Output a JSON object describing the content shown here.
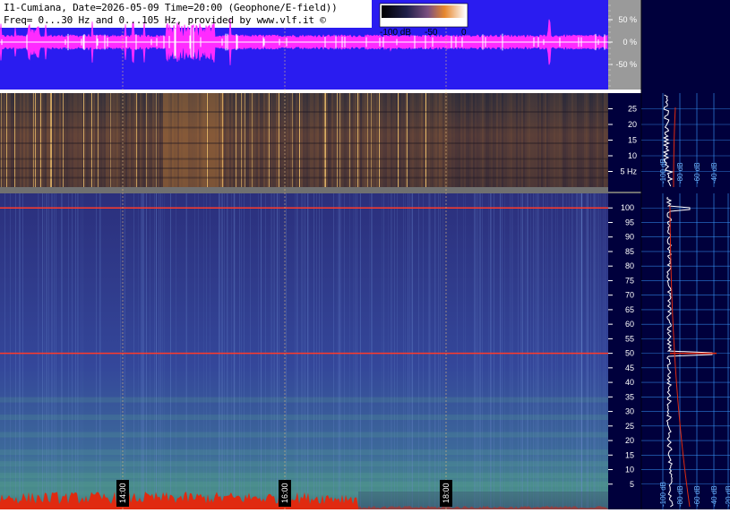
{
  "header": {
    "line1": "I1-Cumiana, Date=2026-05-09 Time=20:00 (Geophone/E-field))",
    "line2": "Freq= 0...30 Hz and 0...105 Hz, provided by www.vlf.it ©"
  },
  "colorbar": {
    "labels": [
      "-100 dB",
      "-50",
      "0"
    ]
  },
  "colors": {
    "waveform_bg": "#2a1cf0",
    "waveform": "#ff2bff",
    "spectrogram_low_bg": "#3a2a38",
    "spectrogram_high_bg": "#2e3f8e",
    "side_bg": "#00003c",
    "grid": "#3a9bff",
    "line_50hz": "#ff3a2a"
  },
  "chart_data": [
    {
      "type": "line",
      "panel": "waveform",
      "ylabel_ticks": [
        "50 %",
        "0 %",
        "-50 %"
      ],
      "y_ticks": [
        50,
        0,
        -50
      ],
      "ylim": [
        -100,
        100
      ]
    },
    {
      "type": "heatmap",
      "panel": "spectrogram_0_30Hz",
      "y_ticks": [
        25,
        20,
        15,
        10,
        5
      ],
      "y_tick_labels": [
        "25",
        "20",
        "15",
        "10",
        "5 Hz"
      ],
      "ylim": [
        0,
        30
      ]
    },
    {
      "type": "heatmap",
      "panel": "spectrogram_0_105Hz",
      "y_ticks": [
        100,
        95,
        90,
        85,
        80,
        75,
        70,
        65,
        60,
        55,
        50,
        45,
        40,
        35,
        30,
        25,
        20,
        15,
        10,
        5
      ],
      "ylim": [
        0,
        105
      ],
      "time_labels": [
        "14:00",
        "16:00",
        "18:00"
      ]
    },
    {
      "type": "line",
      "panel": "spectrum_low",
      "x_tick_labels": [
        "-100 dB",
        "-80 dB",
        "-60 dB",
        "-40 dB"
      ]
    },
    {
      "type": "line",
      "panel": "spectrum_high",
      "x_tick_labels": [
        "-100 dB",
        "-80 dB",
        "-60 dB",
        "-40 dB",
        "-20 dB"
      ]
    }
  ]
}
